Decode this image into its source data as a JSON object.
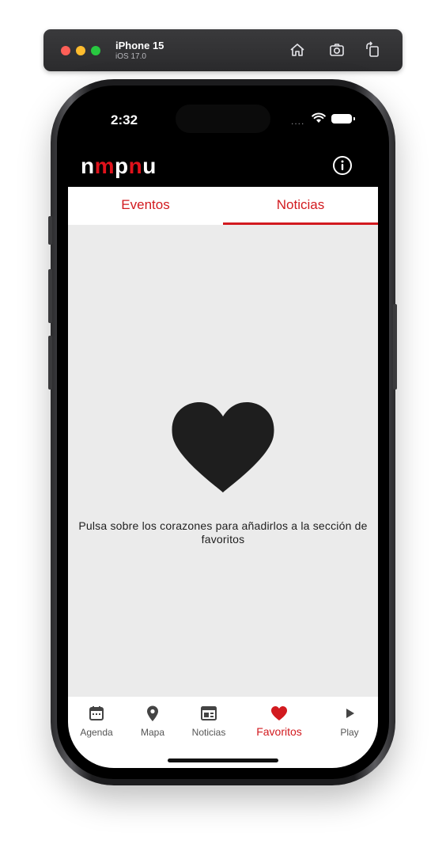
{
  "simulator": {
    "device_name": "iPhone 15",
    "os_version": "iOS 17.0",
    "icons": [
      "home-icon",
      "screenshot-icon",
      "rotate-icon"
    ]
  },
  "status_bar": {
    "time": "2:32",
    "signal": "....",
    "icons": [
      "wifi-icon",
      "battery-icon"
    ]
  },
  "header": {
    "logo_parts": [
      "n",
      "m",
      "p",
      "n",
      "u"
    ],
    "logo_colors": [
      "#ffffff",
      "#e0121b",
      "#ffffff",
      "#e0121b",
      "#ffffff"
    ],
    "info_icon": "info-icon"
  },
  "tabs": [
    {
      "label": "Eventos",
      "selected": false
    },
    {
      "label": "Noticias",
      "selected": true
    }
  ],
  "content": {
    "icon": "heart-icon",
    "message": "Pulsa sobre los corazones para añadirlos a la sección de favoritos"
  },
  "bottom_nav": [
    {
      "label": "Agenda",
      "icon": "calendar-icon",
      "active": false
    },
    {
      "label": "Mapa",
      "icon": "map-pin-icon",
      "active": false
    },
    {
      "label": "Noticias",
      "icon": "newspaper-icon",
      "active": false
    },
    {
      "label": "Favoritos",
      "icon": "heart-icon",
      "active": true
    },
    {
      "label": "Play",
      "icon": "play-icon",
      "active": false
    }
  ],
  "colors": {
    "accent": "#d21a1f",
    "header_bg": "#000000",
    "content_bg": "#ebebeb"
  }
}
